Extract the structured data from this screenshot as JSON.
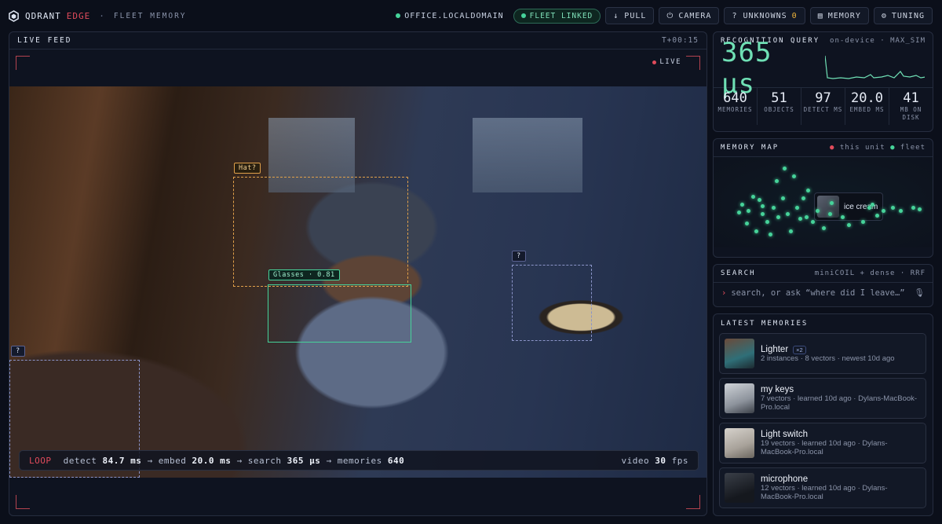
{
  "brand": {
    "name": "QDRANT",
    "edge": "EDGE",
    "sep": "·",
    "subtitle": "FLEET MEMORY"
  },
  "topbar": {
    "host": "OFFICE.LOCALDOMAIN",
    "fleet": "FLEET LINKED",
    "pull": "↓ PULL",
    "camera": "CAMERA",
    "unknowns_label": "? UNKNOWNS",
    "unknowns_count": "0",
    "memory": "MEMORY",
    "tuning": "TUNING"
  },
  "feed": {
    "title": "LIVE FEED",
    "timer": "T+00:15",
    "live": "LIVE",
    "tags": {
      "hat": "Hat?",
      "glasses": "Glasses · 0.81",
      "clock": "?",
      "chair": "?"
    },
    "loop": {
      "label": "LOOP",
      "detect_l": "detect",
      "detect": "84.7 ms",
      "embed_l": "embed",
      "embed": "20.0 ms",
      "search_l": "search",
      "search": "365 µs",
      "mem_l": "memories",
      "mem": "640",
      "video_l": "video",
      "video": "30",
      "fps": "fps",
      "arrow": "→"
    }
  },
  "query": {
    "title": "RECOGNITION QUERY",
    "meta": "on-device · MAX_SIM",
    "latency": "365 µs",
    "stats": [
      {
        "v": "640",
        "l": "MEMORIES"
      },
      {
        "v": "51",
        "l": "OBJECTS"
      },
      {
        "v": "97",
        "l": "DETECT MS"
      },
      {
        "v": "20.0",
        "l": "EMBED MS"
      },
      {
        "v": "41",
        "l": "MB ON DISK"
      }
    ]
  },
  "map": {
    "title": "MEMORY MAP",
    "legend_unit": "this unit",
    "legend_fleet": "fleet",
    "popup": "ice cream"
  },
  "search": {
    "title": "SEARCH",
    "meta": "miniCOIL + dense · RRF",
    "placeholder": "search, or ask “where did I leave…”",
    "caret": "›"
  },
  "memories": {
    "title": "LATEST MEMORIES",
    "items": [
      {
        "name": "Lighter",
        "badge": "×2",
        "meta": "2 instances · 8 vectors · newest 10d ago"
      },
      {
        "name": "my keys",
        "meta": "7 vectors · learned 10d ago · Dylans-MacBook-Pro.local"
      },
      {
        "name": "Light switch",
        "meta": "19 vectors · learned 10d ago · Dylans-MacBook-Pro.local"
      },
      {
        "name": "microphone",
        "meta": "12 vectors · learned 10d ago · Dylans-MacBook-Pro.local"
      }
    ]
  },
  "colors": {
    "accent_green": "#46d39a",
    "accent_red": "#e04b5b",
    "warning_amber": "#f0b43a"
  }
}
